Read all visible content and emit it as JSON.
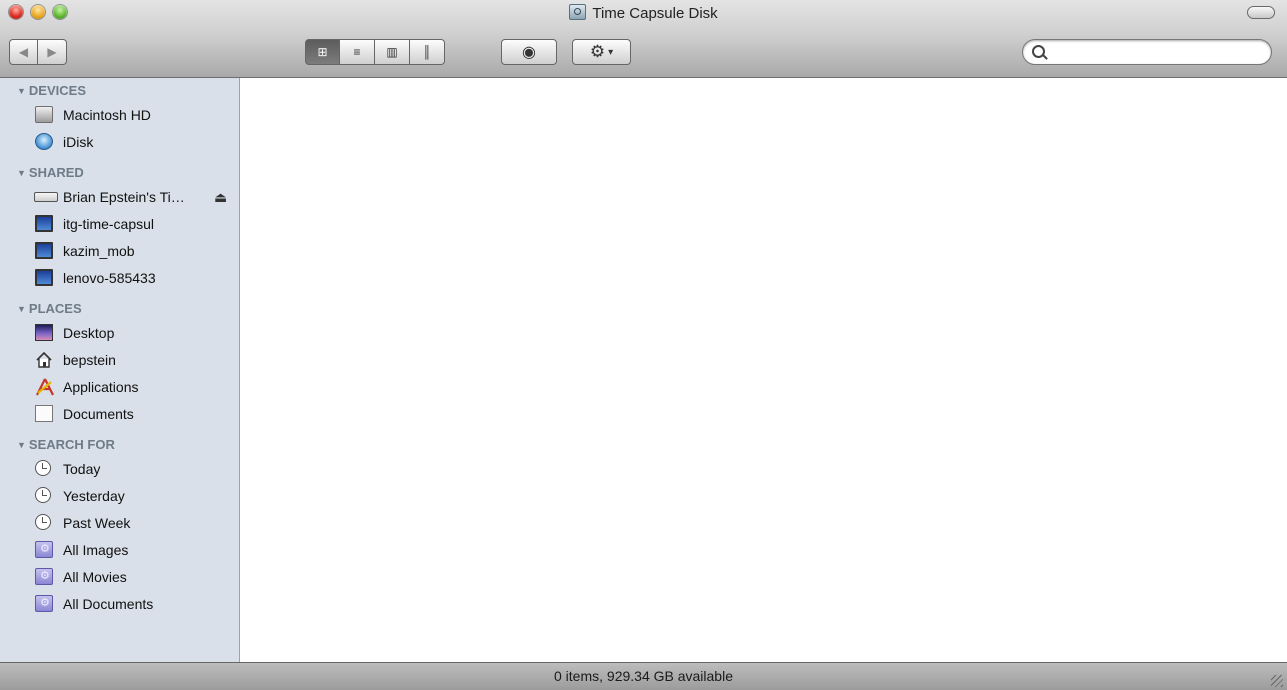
{
  "window": {
    "title": "Time Capsule Disk"
  },
  "toolbar": {
    "back_icon": "◀",
    "forward_icon": "▶",
    "view_icons": [
      "⊞",
      "≡",
      "▥",
      "║"
    ],
    "quicklook_icon": "◉",
    "action_icon": "⚙",
    "action_caret": "▾"
  },
  "search": {
    "value": "",
    "placeholder": ""
  },
  "sidebar": {
    "groups": [
      {
        "title": "DEVICES",
        "items": [
          {
            "label": "Macintosh HD"
          },
          {
            "label": "iDisk"
          }
        ]
      },
      {
        "title": "SHARED",
        "items": [
          {
            "label": "Brian Epstein's Ti…"
          },
          {
            "label": "itg-time-capsul"
          },
          {
            "label": "kazim_mob"
          },
          {
            "label": "lenovo-585433"
          }
        ]
      },
      {
        "title": "PLACES",
        "items": [
          {
            "label": "Desktop"
          },
          {
            "label": "bepstein"
          },
          {
            "label": "Applications"
          },
          {
            "label": "Documents"
          }
        ]
      },
      {
        "title": "SEARCH FOR",
        "items": [
          {
            "label": "Today"
          },
          {
            "label": "Yesterday"
          },
          {
            "label": "Past Week"
          },
          {
            "label": "All Images"
          },
          {
            "label": "All Movies"
          },
          {
            "label": "All Documents"
          }
        ]
      }
    ],
    "eject_icon": "⏏"
  },
  "status": {
    "text": "0 items, 929.34 GB available"
  }
}
